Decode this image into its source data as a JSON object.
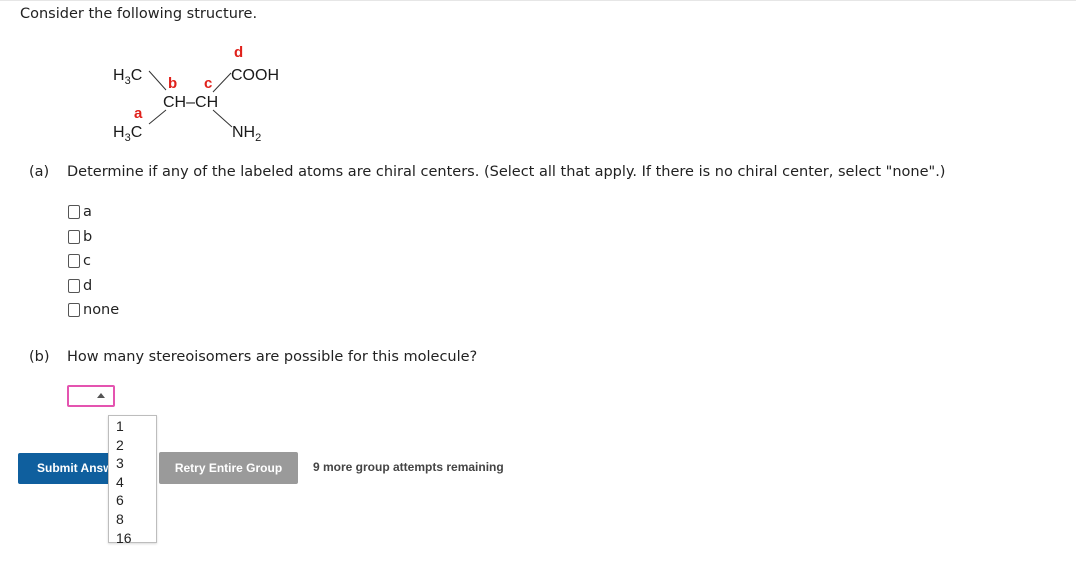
{
  "intro": "Consider the following structure.",
  "molecule": {
    "atoms": {
      "h3c_top_main": "H",
      "h3c_top_sub": "3",
      "h3c_top_c": "C",
      "h3c_bottom_main": "H",
      "h3c_bottom_sub": "3",
      "h3c_bottom_c": "C",
      "ch_ch": "CH–CH",
      "cooh": "COOH",
      "nh2_main": "NH",
      "nh2_sub": "2"
    },
    "labels": {
      "a": "a",
      "b": "b",
      "c": "c",
      "d": "d"
    },
    "label_color": "#e0211b"
  },
  "part_a": {
    "number": "(a)",
    "question": "Determine if any of the labeled atoms are chiral centers. (Select all that apply. If there is no chiral center, select \"none\".)",
    "options": [
      "a",
      "b",
      "c",
      "d",
      "none"
    ]
  },
  "part_b": {
    "number": "(b)",
    "question": "How many stereoisomers are possible for this molecule?",
    "dropdown_options": [
      "1",
      "2",
      "3",
      "4",
      "6",
      "8",
      "16"
    ]
  },
  "footer": {
    "submit_label": "Submit Answer",
    "retry_label": "Retry Entire Group",
    "attempts_text": "9 more group attempts remaining"
  },
  "colors": {
    "submit_bg": "#0f5f9e",
    "retry_bg": "#9a9a9a",
    "dropdown_border": "#e454b0"
  }
}
